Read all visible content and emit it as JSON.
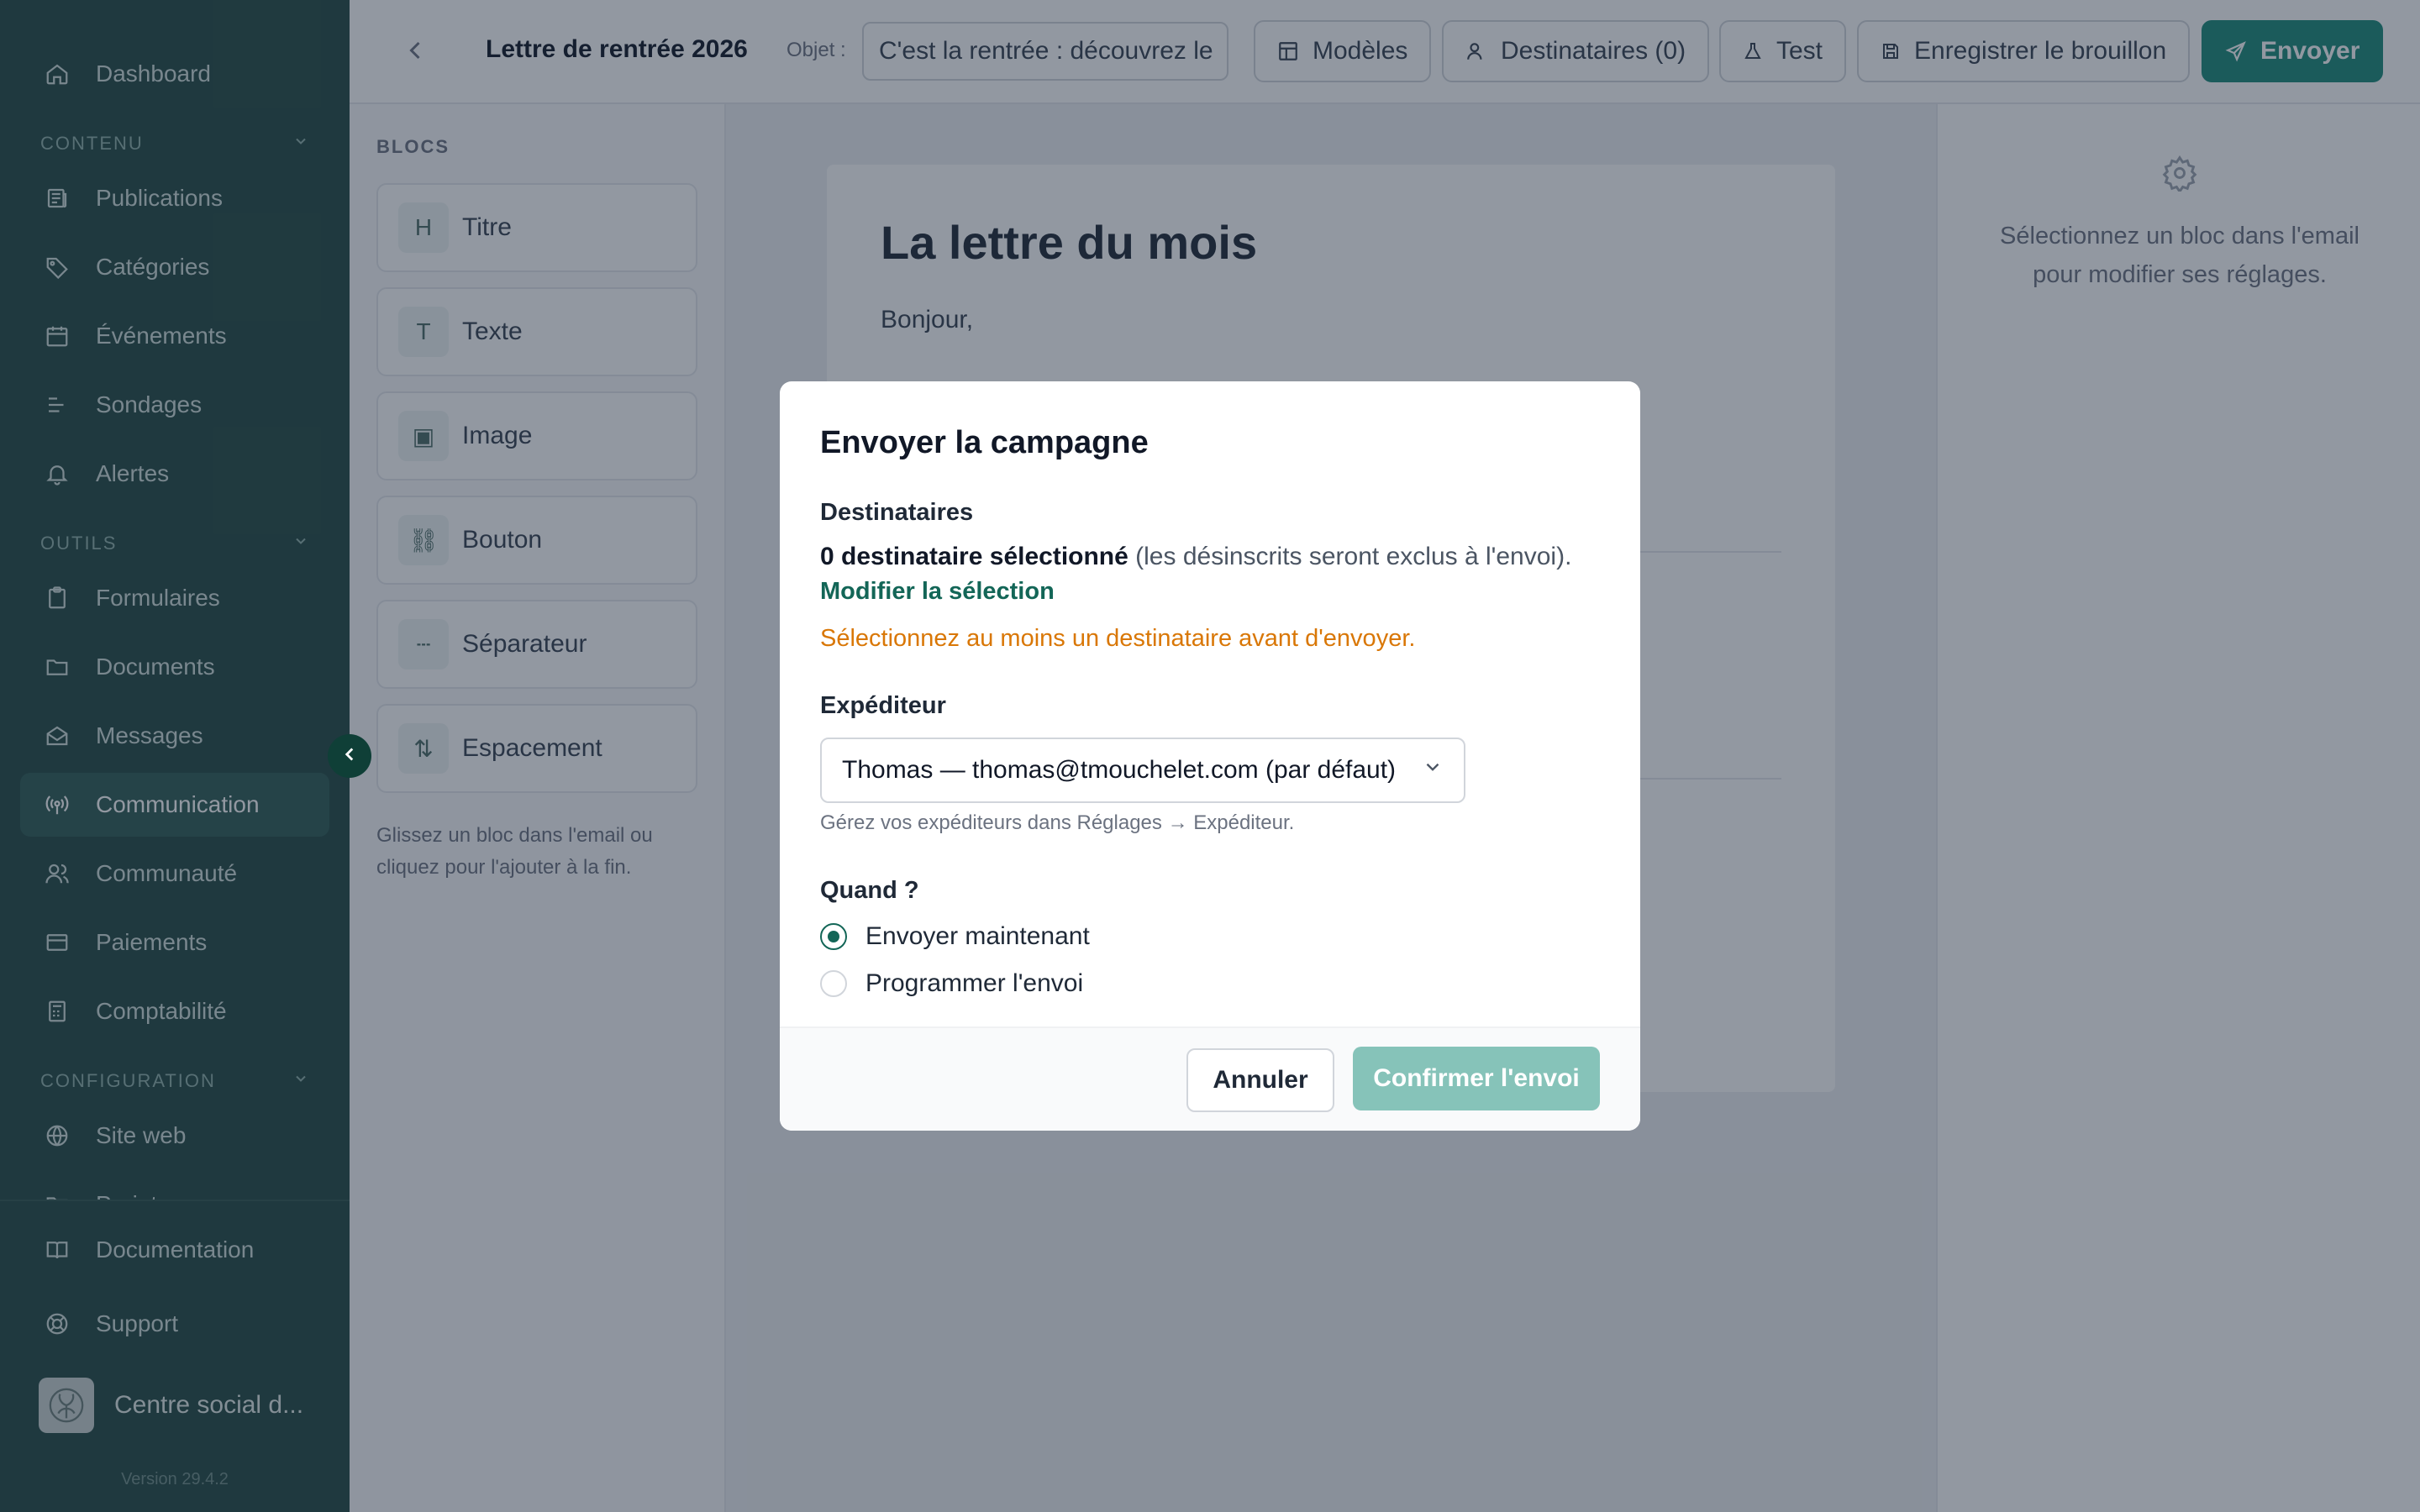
{
  "sidebar": {
    "dashboard": "Dashboard",
    "section_content": "CONTENU",
    "content_items": [
      {
        "label": "Publications",
        "icon": "newspaper-icon"
      },
      {
        "label": "Catégories",
        "icon": "tag-icon"
      },
      {
        "label": "Événements",
        "icon": "calendar-icon"
      },
      {
        "label": "Sondages",
        "icon": "bars-icon"
      },
      {
        "label": "Alertes",
        "icon": "bell-icon"
      }
    ],
    "section_tools": "OUTILS",
    "tool_items": [
      {
        "label": "Formulaires",
        "icon": "clipboard-icon"
      },
      {
        "label": "Documents",
        "icon": "folder-icon"
      },
      {
        "label": "Messages",
        "icon": "mail-icon"
      },
      {
        "label": "Communication",
        "icon": "broadcast-icon",
        "active": true
      },
      {
        "label": "Communauté",
        "icon": "users-icon"
      },
      {
        "label": "Paiements",
        "icon": "card-icon"
      },
      {
        "label": "Comptabilité",
        "icon": "calculator-icon"
      }
    ],
    "section_config": "CONFIGURATION",
    "config_items": [
      {
        "label": "Site web",
        "icon": "globe-icon"
      },
      {
        "label": "Projet",
        "icon": "folder-icon"
      }
    ],
    "footer_items": [
      {
        "label": "Documentation",
        "icon": "book-icon"
      },
      {
        "label": "Support",
        "icon": "lifebuoy-icon"
      }
    ],
    "org_name": "Centre social d...",
    "version": "Version 29.4.2"
  },
  "topbar": {
    "title": "Lettre de rentrée 2026",
    "subject_label": "Objet :",
    "subject_value": "C'est la rentrée : découvrez le",
    "templates": "Modèles",
    "recipients": "Destinataires (0)",
    "test": "Test",
    "save_draft": "Enregistrer le brouillon",
    "send": "Envoyer"
  },
  "blocks": {
    "title": "BLOCS",
    "items": [
      {
        "glyph": "H",
        "label": "Titre"
      },
      {
        "glyph": "T",
        "label": "Texte"
      },
      {
        "glyph": "▣",
        "label": "Image"
      },
      {
        "glyph": "⛓",
        "label": "Bouton"
      },
      {
        "glyph": "┄",
        "label": "Séparateur"
      },
      {
        "glyph": "⇅",
        "label": "Espacement"
      }
    ],
    "hint": "Glissez un bloc dans l'email ou cliquez pour l'ajouter à la fin."
  },
  "email": {
    "title": "La lettre du mois",
    "greeting": "Bonjour,"
  },
  "settings": {
    "placeholder": "Sélectionnez un bloc dans l'email pour modifier ses réglages."
  },
  "modal": {
    "title": "Envoyer la campagne",
    "recipients_label": "Destinataires",
    "recipients_count": "0 destinataire sélectionné",
    "recipients_note": "(les désinscrits seront exclus à l'envoi).",
    "modify_link": "Modifier la sélection",
    "warning": "Sélectionnez au moins un destinataire avant d'envoyer.",
    "sender_label": "Expéditeur",
    "sender_value": "Thomas — thomas@tmouchelet.com (par défaut)",
    "sender_help": "Gérez vos expéditeurs dans Réglages → Expéditeur.",
    "when_label": "Quand ?",
    "option_now": "Envoyer maintenant",
    "option_schedule": "Programmer l'envoi",
    "cancel": "Annuler",
    "confirm": "Confirmer l'envoi"
  },
  "colors": {
    "accent": "#136657",
    "warning": "#d97706",
    "sidebar_bg": "#244a44"
  }
}
